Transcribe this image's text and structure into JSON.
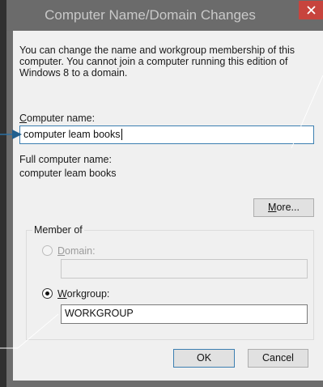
{
  "dialog": {
    "title": "Computer Name/Domain Changes",
    "close_label": "✕",
    "intro": "You can change the name and workgroup membership of this computer. You cannot join a computer running this edition of Windows 8 to a domain.",
    "computer_name": {
      "label_first": "C",
      "label_rest": "omputer name:",
      "value": "computer leam books"
    },
    "full_name": {
      "label": "Full computer name:",
      "value": "computer leam books"
    },
    "more_button": {
      "label_first": "M",
      "label_rest": "ore..."
    },
    "member_of": {
      "title": "Member of",
      "domain": {
        "label_first": "D",
        "label_rest": "omain:",
        "selected": false,
        "enabled": false,
        "value": ""
      },
      "workgroup": {
        "label_first": "W",
        "label_rest": "orkgroup:",
        "selected": true,
        "value": "WORKGROUP"
      }
    },
    "ok_label": "OK",
    "cancel_label": "Cancel"
  },
  "colors": {
    "titlebar": "#6b6b6b",
    "client": "#f0f0f0",
    "close": "#c7443d",
    "focus_border": "#3c7fb1",
    "annotation_line": "#2a6fa1"
  },
  "annotations": {
    "arrow_to_computer_name": true,
    "callout_lines": 2
  }
}
